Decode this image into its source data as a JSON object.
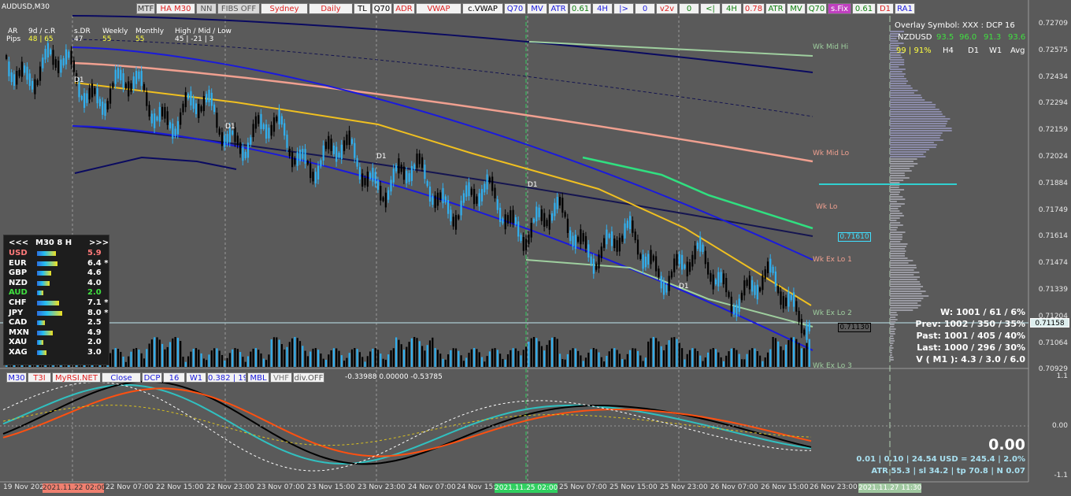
{
  "symbol_title": "AUDUSD,M30",
  "toolbar": [
    {
      "label": "MTF",
      "bg": "#d8d8d8",
      "fg": "#333333",
      "w": 24
    },
    {
      "label": "HA M30",
      "bg": "#f2f2f2",
      "fg": "#e02020",
      "w": 50
    },
    {
      "label": "NN",
      "bg": "#d8d8d8",
      "fg": "#555555",
      "w": 26
    },
    {
      "label": "FIBS OFF",
      "bg": "#d8d8d8",
      "fg": "#555555",
      "w": 54
    },
    {
      "label": "Sydney",
      "bg": "#f2f2f2",
      "fg": "#e02020",
      "w": 60
    },
    {
      "label": "Daily",
      "bg": "#f2f2f2",
      "fg": "#e02020",
      "w": 56
    },
    {
      "label": "TL",
      "bg": "#f2f2f2",
      "fg": "#000000",
      "w": 22
    },
    {
      "label": "Q70",
      "bg": "#f2f2f2",
      "fg": "#000000",
      "w": 26
    },
    {
      "label": "ADR",
      "bg": "#f2f2f2",
      "fg": "#e02020",
      "w": 28
    },
    {
      "label": "VWAP",
      "bg": "#f2f2f2",
      "fg": "#e02020",
      "w": 58
    },
    {
      "label": "c.VWAP",
      "bg": "#f2f2f2",
      "fg": "#000000",
      "w": 52
    },
    {
      "label": "Q70",
      "bg": "#f2f2f2",
      "fg": "#1a1adc",
      "w": 28
    },
    {
      "label": "MV",
      "bg": "#f2f2f2",
      "fg": "#1a1adc",
      "w": 26
    },
    {
      "label": "ATR",
      "bg": "#f2f2f2",
      "fg": "#1a1adc",
      "w": 26
    },
    {
      "label": "0.61",
      "bg": "#f2f2f2",
      "fg": "#108010",
      "w": 28
    },
    {
      "label": "4H",
      "bg": "#f2f2f2",
      "fg": "#1a1adc",
      "w": 26
    },
    {
      "label": "|>",
      "bg": "#f2f2f2",
      "fg": "#1a1adc",
      "w": 26
    },
    {
      "label": "0",
      "bg": "#f2f2f2",
      "fg": "#1a1adc",
      "w": 26
    },
    {
      "label": "v2v",
      "bg": "#f2f2f2",
      "fg": "#e02020",
      "w": 28
    },
    {
      "label": "0",
      "bg": "#f2f2f2",
      "fg": "#108010",
      "w": 26
    },
    {
      "label": "<|",
      "bg": "#f2f2f2",
      "fg": "#108010",
      "w": 26
    },
    {
      "label": "4H",
      "bg": "#f2f2f2",
      "fg": "#108010",
      "w": 26
    },
    {
      "label": "0.78",
      "bg": "#f2f2f2",
      "fg": "#e02020",
      "w": 28
    },
    {
      "label": "ATR",
      "bg": "#f2f2f2",
      "fg": "#108010",
      "w": 26
    },
    {
      "label": "MV",
      "bg": "#f2f2f2",
      "fg": "#108010",
      "w": 24
    },
    {
      "label": "Q70",
      "bg": "#f2f2f2",
      "fg": "#108010",
      "w": 26
    },
    {
      "label": "s.Fix",
      "bg": "#c040c0",
      "fg": "#ffffff",
      "w": 30
    },
    {
      "label": "0.61",
      "bg": "#f2f2f2",
      "fg": "#108010",
      "w": 30
    },
    {
      "label": "D1",
      "bg": "#f2f2f2",
      "fg": "#e02020",
      "w": 22
    },
    {
      "label": "RA1",
      "bg": "#f2f2f2",
      "fg": "#1a1adc",
      "w": 26
    }
  ],
  "stats_header": {
    "col1": "AR",
    "col1b": "Pips",
    "col2": "9d / c.R",
    "col2v": "48 | 65",
    "col3": "s.DR",
    "col3v": "47",
    "col4": "Weekly",
    "col4v": "55",
    "col5": "Monthly",
    "col5v": "55",
    "col6": "High / Mid / Low",
    "col6v": "45  |  -21  |  3"
  },
  "overlay": {
    "title": "Overlay Symbol: XXX : DCP 16",
    "symbol": "NZDUSD",
    "v1": "93.5",
    "v2": "96.0",
    "v3": "91.3",
    "v4": "93.6",
    "pct": "99 | 91%",
    "tf1": "H4",
    "tf2": "D1",
    "tf3": "W1",
    "tf4": "Avg"
  },
  "price_axis": [
    "0.72709",
    "0.72575",
    "0.72434",
    "0.72294",
    "0.72159",
    "0.72024",
    "0.71884",
    "0.71749",
    "0.71614",
    "0.71474",
    "0.71339",
    "0.71204",
    "0.71064",
    "0.70929"
  ],
  "current_price": "0.71158",
  "level_labels": [
    {
      "text": "Wk Mid Hi",
      "color": "#9fcf9f"
    },
    {
      "text": "Wk Mid Lo",
      "color": "#f0a090"
    },
    {
      "text": "Wk Lo",
      "color": "#f0a090"
    },
    {
      "text": "Wk Ex Lo 1",
      "color": "#f0a090"
    },
    {
      "text": "Wk Ex Lo 2",
      "color": "#9fcf9f"
    },
    {
      "text": "Wk Ex Lo 3",
      "color": "#9fcf9f"
    }
  ],
  "price_boxes": [
    "0.71610",
    "0.71130"
  ],
  "d1_markers": [
    "D1",
    "D1",
    "D1",
    "D1",
    "D1"
  ],
  "strength": {
    "header_left": "<<<",
    "header_mid": "M30  8  H",
    "header_right": ">>>",
    "rows": [
      {
        "code": "USD",
        "value": "5.9",
        "color": "#ff7a7a",
        "level": 5.9
      },
      {
        "code": "EUR",
        "value": "6.4 *",
        "color": "#ffffff",
        "level": 6.4
      },
      {
        "code": "GBP",
        "value": "4.6",
        "color": "#ffffff",
        "level": 4.6
      },
      {
        "code": "NZD",
        "value": "4.0",
        "color": "#ffffff",
        "level": 4.0
      },
      {
        "code": "AUD",
        "value": "2.0",
        "color": "#40e040",
        "level": 2.0
      },
      {
        "code": "CHF",
        "value": "7.1 *",
        "color": "#ffffff",
        "level": 7.1
      },
      {
        "code": "JPY",
        "value": "8.0 *",
        "color": "#ffffff",
        "level": 8.0
      },
      {
        "code": "CAD",
        "value": "2.5",
        "color": "#ffffff",
        "level": 2.5
      },
      {
        "code": "MXN",
        "value": "4.9",
        "color": "#ffffff",
        "level": 4.9
      },
      {
        "code": "XAU",
        "value": "2.0",
        "color": "#ffffff",
        "level": 2.0
      },
      {
        "code": "XAG",
        "value": "3.0",
        "color": "#ffffff",
        "level": 3.0
      }
    ]
  },
  "right_stats": [
    "W: 1001 / 61 / 6%",
    "Prev: 1002 / 350 / 35%",
    "Past: 1001 / 405 / 40%",
    "Last: 1000 / 296 / 30%",
    "V ( M1 ): 4.3 / 3.0 / 6.0"
  ],
  "subwindow": {
    "buttons": [
      {
        "label": "M30",
        "fg": "#1a1adc",
        "w": 26
      },
      {
        "label": "T3I",
        "fg": "#e02020",
        "w": 30
      },
      {
        "label": "MyRSI.NET",
        "fg": "#e02020",
        "w": 62
      },
      {
        "label": "Close",
        "fg": "#1a1adc",
        "w": 50
      },
      {
        "label": "DCP",
        "fg": "#1a1adc",
        "w": 26
      },
      {
        "label": "16",
        "fg": "#1a1adc",
        "w": 28
      },
      {
        "label": "W1",
        "fg": "#1a1adc",
        "w": 26
      },
      {
        "label": "0.382 | 19",
        "fg": "#1a1adc",
        "w": 50
      },
      {
        "label": "MBL",
        "fg": "#1a1adc",
        "w": 28
      },
      {
        "label": "VHF",
        "fg": "#777777",
        "w": 28
      },
      {
        "label": "div.OFF",
        "fg": "#555555",
        "w": 40
      }
    ],
    "values_readout": "-0.33988  0.00000  -0.53785",
    "big_value": "0.00",
    "line1": "0.01  |  0.10  |  24.54 USD = 245.4  |  2.0%",
    "line2": "ATR 55.3  | sl 34.2  |  tp 70.8  |  N 0.07",
    "axis": [
      "1.1",
      "0.00",
      "-1.1"
    ]
  },
  "time_axis": [
    "19 Nov 2021",
    "22 Nov 07:00",
    "22 Nov 15:00",
    "22 Nov 23:00",
    "23 Nov 07:00",
    "23 Nov 15:00",
    "23 Nov 23:00",
    "24 Nov 07:00",
    "24 Nov 15:00",
    "25 Nov 07:00",
    "25 Nov 15:00",
    "25 Nov 23:00",
    "26 Nov 07:00",
    "26 Nov 15:00",
    "26 Nov 23:00"
  ],
  "time_markers": [
    {
      "text": "2021.11.22 02:00",
      "bg": "#f08070",
      "fg": "#333333"
    },
    {
      "text": "2021.11.25 02:00",
      "bg": "#30d060",
      "fg": "#ffffff"
    },
    {
      "text": "2021.11.27 11:30",
      "bg": "#a0c8a0",
      "fg": "#ffffff"
    }
  ]
}
